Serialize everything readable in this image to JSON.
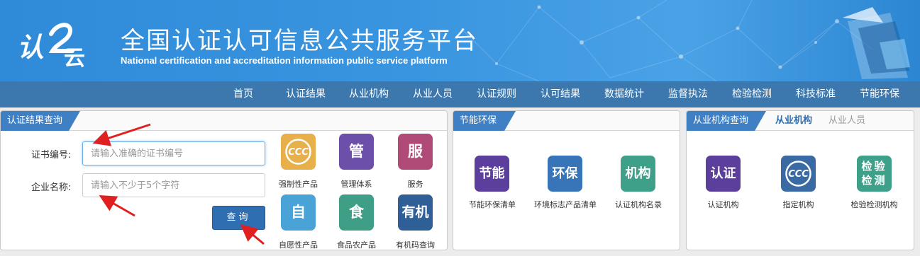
{
  "header": {
    "logo_text": "认证云",
    "title_cn": "全国认证认可信息公共服务平台",
    "title_en": "National certification and accreditation information public service platform"
  },
  "nav": [
    "首页",
    "认证结果",
    "从业机构",
    "从业人员",
    "认证规则",
    "认可结果",
    "数据统计",
    "监督执法",
    "检验检测",
    "科技标准",
    "节能环保"
  ],
  "query_panel": {
    "tab": "认证结果查询",
    "cert_label": "证书编号:",
    "cert_placeholder": "请输入准确的证书编号",
    "company_label": "企业名称:",
    "company_placeholder": "请输入不少于5个字符",
    "search_button": "查询",
    "tiles": [
      {
        "glyph": "CCC",
        "label": "强制性产品",
        "color": "#e8b04a"
      },
      {
        "glyph": "管",
        "label": "管理体系",
        "color": "#6b4fa8"
      },
      {
        "glyph": "服",
        "label": "服务",
        "color": "#b04a76"
      },
      {
        "glyph": "自",
        "label": "自愿性产品",
        "color": "#4aa3d6"
      },
      {
        "glyph": "食",
        "label": "食品农产品",
        "color": "#3f9e86"
      },
      {
        "glyph": "有机",
        "label": "有机码查询",
        "color": "#2e5f96"
      }
    ]
  },
  "energy_panel": {
    "tab": "节能环保",
    "tiles": [
      {
        "glyph": "节能",
        "label": "节能环保清单",
        "color": "#5c3f9c"
      },
      {
        "glyph": "环保",
        "label": "环境标志产品清单",
        "color": "#3775b8"
      },
      {
        "glyph": "机构",
        "label": "认证机构名录",
        "color": "#3fa08a"
      }
    ]
  },
  "org_panel": {
    "tab": "从业机构查询",
    "sub_tabs": [
      "从业机构",
      "从业人员"
    ],
    "tiles": [
      {
        "glyph": "认证",
        "label": "认证机构",
        "color": "#5c3f9c"
      },
      {
        "glyph": "CCC",
        "label": "指定机构",
        "color": "#3a6aa3"
      },
      {
        "glyph": "检验检测",
        "label": "检验检测机构",
        "color": "#3fa08a"
      }
    ]
  },
  "colors": {
    "nav_bg": "#3c78ad",
    "tab_bg": "#3f7fc3",
    "arrow": "#e02020"
  }
}
